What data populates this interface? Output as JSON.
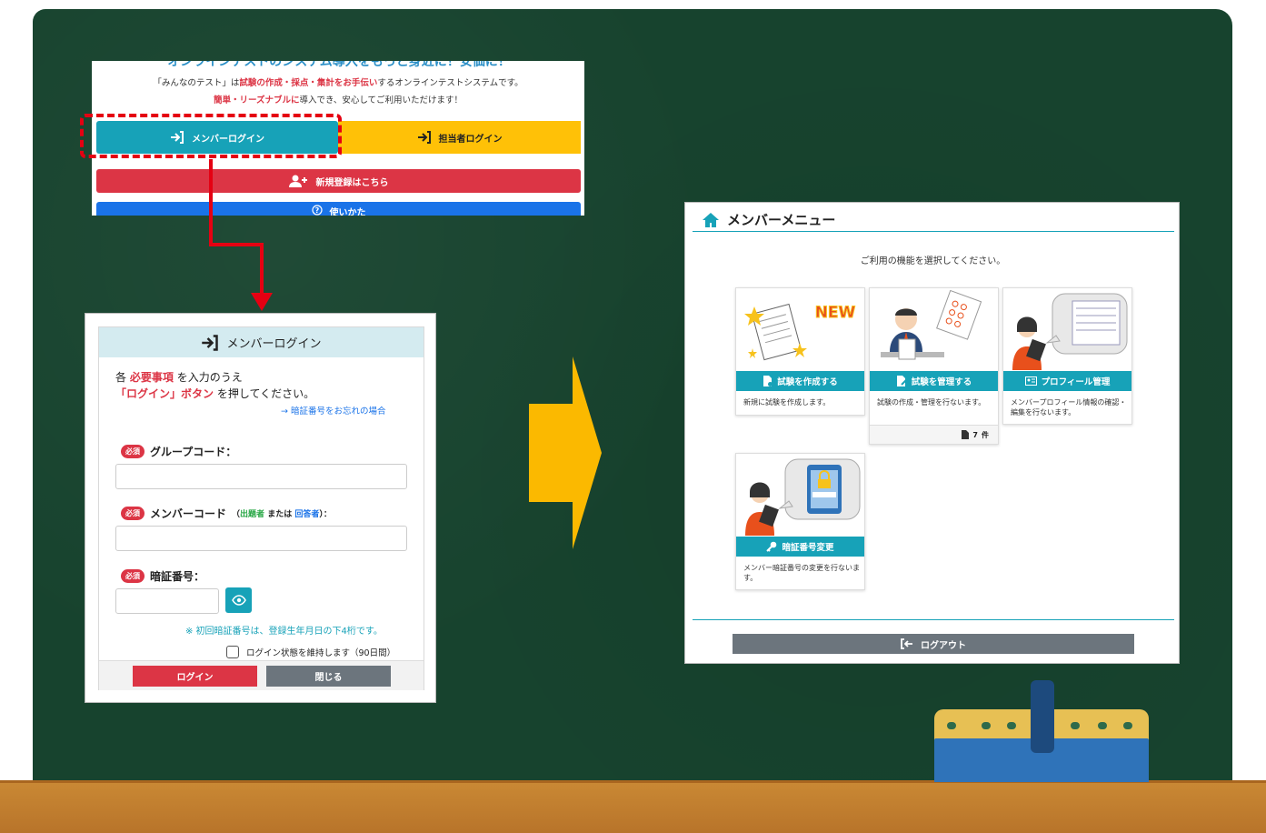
{
  "snippet": {
    "headline": "オンラインテストのシステム導入をもっと身近に！安価に！",
    "line1_pre": "「みんなのテスト」は",
    "line1_red": "試験の作成・採点・集計をお手伝い",
    "line1_post": "するオンラインテストシステムです。",
    "line2_red": "簡単・リーズナブルに",
    "line2_post": "導入でき、安心してご利用いただけます！",
    "member_login": "メンバーログイン",
    "staff_login": "担当者ログイン",
    "register": "新規登録はこちら",
    "howto": "使いかた"
  },
  "login": {
    "title": "メンバーログイン",
    "intro_prefix": "各",
    "intro_req": "必要事項",
    "intro_rest": "を入力のうえ",
    "intro_btn": "「ログイン」ボタン",
    "intro_end": "を押してください。",
    "forgot": "→ 暗証番号をお忘れの場合",
    "required": "必須",
    "group_label": "グループコード：",
    "member_label": "メンバーコード",
    "paren_open": "（",
    "setter": "出題者",
    "or": "または",
    "answerer": "回答者",
    "paren_close": "）：",
    "password_label": "暗証番号：",
    "password_note": "※ 初回暗証番号は、登録生年月日の下4桁です。",
    "keep_login": "ログイン状態を維持します（90日間）",
    "login_button": "ログイン",
    "close_button": "閉じる"
  },
  "menu": {
    "title": "メンバーメニュー",
    "subtitle": "ご利用の機能を選択してください。",
    "cards": [
      {
        "title": "試験を作成する",
        "desc": "新規に試験を作成します。",
        "badge": "NEW"
      },
      {
        "title": "試験を管理する",
        "desc": "試験の作成・管理を行ないます。",
        "count": "7",
        "count_unit": "件"
      },
      {
        "title": "プロフィール管理",
        "desc": "メンバープロフィール情報の確認・編集を行ないます。"
      },
      {
        "title": "暗証番号変更",
        "desc": "メンバー暗証番号の変更を行ないます。"
      }
    ],
    "logout": "ログアウト"
  },
  "colors": {
    "teal": "#17a2b8",
    "red": "#dc3545",
    "yellow": "#ffc107",
    "board": "#17432e",
    "arrow": "#fbb900"
  }
}
